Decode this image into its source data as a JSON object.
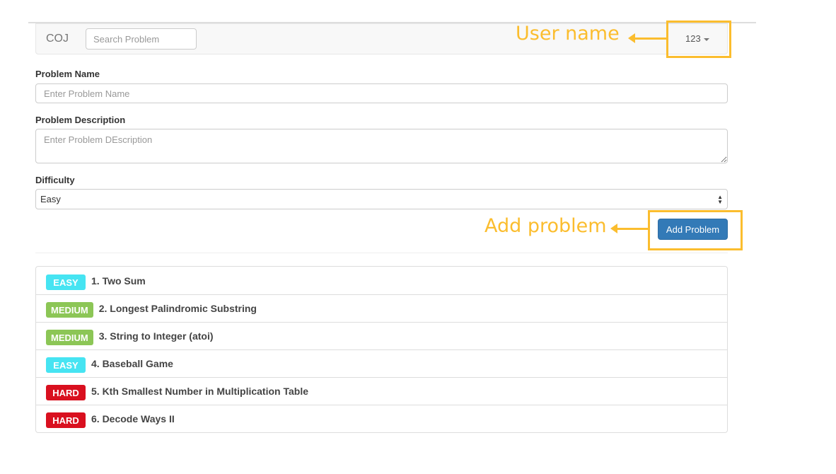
{
  "navbar": {
    "brand": "COJ",
    "search_placeholder": "Search Problem",
    "username": "123"
  },
  "form": {
    "name_label": "Problem Name",
    "name_placeholder": "Enter Problem Name",
    "desc_label": "Problem Description",
    "desc_placeholder": "Enter Problem DEscription",
    "difficulty_label": "Difficulty",
    "difficulty_value": "Easy",
    "submit_label": "Add Problem"
  },
  "problems": [
    {
      "badge": "EASY",
      "color": "#46e4f2",
      "title": "1. Two Sum"
    },
    {
      "badge": "MEDIUM",
      "color": "#8cc656",
      "title": "2. Longest Palindromic Substring"
    },
    {
      "badge": "MEDIUM",
      "color": "#8cc656",
      "title": "3. String to Integer (atoi)"
    },
    {
      "badge": "EASY",
      "color": "#46e4f2",
      "title": "4. Baseball Game"
    },
    {
      "badge": "HARD",
      "color": "#d9101f",
      "title": "5. Kth Smallest Number in Multiplication Table"
    },
    {
      "badge": "HARD",
      "color": "#d9101f",
      "title": "6. Decode Ways II"
    }
  ],
  "annotations": {
    "user": "User name",
    "add": "Add problem",
    "color": "#fbbd2e"
  }
}
